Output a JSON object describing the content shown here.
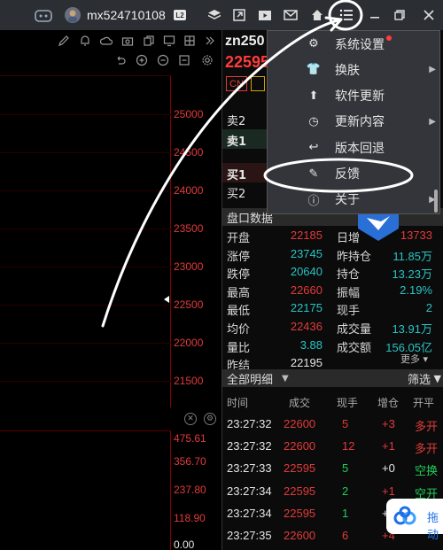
{
  "titlebar": {
    "username": "mx524710108",
    "badge": "L2",
    "icons": [
      "avatar-icon",
      "layers-icon",
      "expand-icon",
      "video-icon",
      "mail-icon",
      "home-icon",
      "menu-icon",
      "minimize-icon",
      "restore-icon",
      "close-icon"
    ]
  },
  "chart_toolbar": {
    "top_icons": [
      "edit-icon",
      "bell-icon",
      "cloud-icon",
      "lock-icon",
      "copy-icon",
      "monitor-icon",
      "grid-icon",
      "chevron-right-icon"
    ],
    "row2_icons": [
      "undo-icon",
      "zoom-in-icon",
      "zoom-out-icon",
      "zoom-reset-icon",
      "settings-icon"
    ]
  },
  "price_axis": [
    "25000",
    "24500",
    "24000",
    "23500",
    "23000",
    "22500",
    "22000",
    "21500"
  ],
  "volume_axis": [
    "475.61",
    "356.70",
    "237.80",
    "118.90",
    "0.00"
  ],
  "quote": {
    "symbol": "zn250",
    "price": "22595",
    "cn_badge": "CN"
  },
  "order_book": {
    "ask2": "卖2",
    "ask1": "卖1",
    "bid1": "买1",
    "bid2": "买2"
  },
  "market_data": {
    "header": "盘口数据",
    "rows": [
      {
        "l1": "开盘",
        "v1": "22185",
        "c1": "#e23a3a",
        "l2": "日增",
        "v2": "13733",
        "c2": "#e23a3a"
      },
      {
        "l1": "涨停",
        "v1": "23745",
        "c1": "#29c3c3",
        "l2": "昨持仓",
        "v2": "11.85万",
        "c2": "#29c3c3"
      },
      {
        "l1": "跌停",
        "v1": "20640",
        "c1": "#29c3c3",
        "l2": "持仓",
        "v2": "13.23万",
        "c2": "#29c3c3"
      },
      {
        "l1": "最高",
        "v1": "22660",
        "c1": "#e23a3a",
        "l2": "振幅",
        "v2": "2.19%",
        "c2": "#29c3c3"
      },
      {
        "l1": "最低",
        "v1": "22175",
        "c1": "#29c3c3",
        "l2": "现手",
        "v2": "2",
        "c2": "#29c3c3"
      },
      {
        "l1": "均价",
        "v1": "22436",
        "c1": "#e23a3a",
        "l2": "成交量",
        "v2": "13.91万",
        "c2": "#29c3c3"
      },
      {
        "l1": "量比",
        "v1": "3.88",
        "c1": "#29c3c3",
        "l2": "成交额",
        "v2": "156.05亿",
        "c2": "#29c3c3"
      },
      {
        "l1": "昨结",
        "v1": "22195",
        "c1": "#e6e6e6",
        "l2": "",
        "v2": "",
        "c2": "#e6e6e6"
      }
    ],
    "more": "更多"
  },
  "ticks": {
    "header": "全部明细",
    "filter": "筛选",
    "columns": [
      "时间",
      "成交",
      "现手",
      "增仓",
      "开平"
    ],
    "rows": [
      {
        "time": "23:27:32",
        "price": "22600",
        "qty": "5",
        "chg": "+3",
        "type": "多开",
        "pc": "#e23a3a",
        "qc": "#e23a3a",
        "cc": "#e23a3a",
        "tc": "#e23a3a"
      },
      {
        "time": "23:27:32",
        "price": "22600",
        "qty": "12",
        "chg": "+1",
        "type": "多开",
        "pc": "#e23a3a",
        "qc": "#e23a3a",
        "cc": "#e23a3a",
        "tc": "#e23a3a"
      },
      {
        "time": "23:27:33",
        "price": "22595",
        "qty": "5",
        "chg": "+0",
        "type": "空换",
        "pc": "#e23a3a",
        "qc": "#1fcf5a",
        "cc": "#e6e6e6",
        "tc": "#1fcf5a"
      },
      {
        "time": "23:27:34",
        "price": "22595",
        "qty": "2",
        "chg": "+1",
        "type": "空开",
        "pc": "#e23a3a",
        "qc": "#1fcf5a",
        "cc": "#e23a3a",
        "tc": "#1fcf5a"
      },
      {
        "time": "23:27:34",
        "price": "22595",
        "qty": "1",
        "chg": "+0",
        "type": "",
        "pc": "#e23a3a",
        "qc": "#1fcf5a",
        "cc": "#e6e6e6",
        "tc": "#1fcf5a"
      },
      {
        "time": "23:27:35",
        "price": "22600",
        "qty": "6",
        "chg": "+4",
        "type": "",
        "pc": "#e23a3a",
        "qc": "#e23a3a",
        "cc": "#e23a3a",
        "tc": "#e23a3a"
      }
    ]
  },
  "menu": {
    "items": [
      {
        "label": "系统设置",
        "icon": "gear-icon",
        "arrow": ""
      },
      {
        "label": "换肤",
        "icon": "shirt-icon",
        "arrow": "▶"
      },
      {
        "label": "软件更新",
        "icon": "upload-icon",
        "arrow": ""
      },
      {
        "label": "更新内容",
        "icon": "clock-icon",
        "arrow": "▶"
      },
      {
        "label": "版本回退",
        "icon": "undo-icon",
        "arrow": ""
      },
      {
        "label": "反馈",
        "icon": "pencil-icon",
        "arrow": ""
      },
      {
        "label": "关于",
        "icon": "info-icon",
        "arrow": "▶"
      }
    ]
  },
  "drag_button": {
    "label": "拖动"
  }
}
